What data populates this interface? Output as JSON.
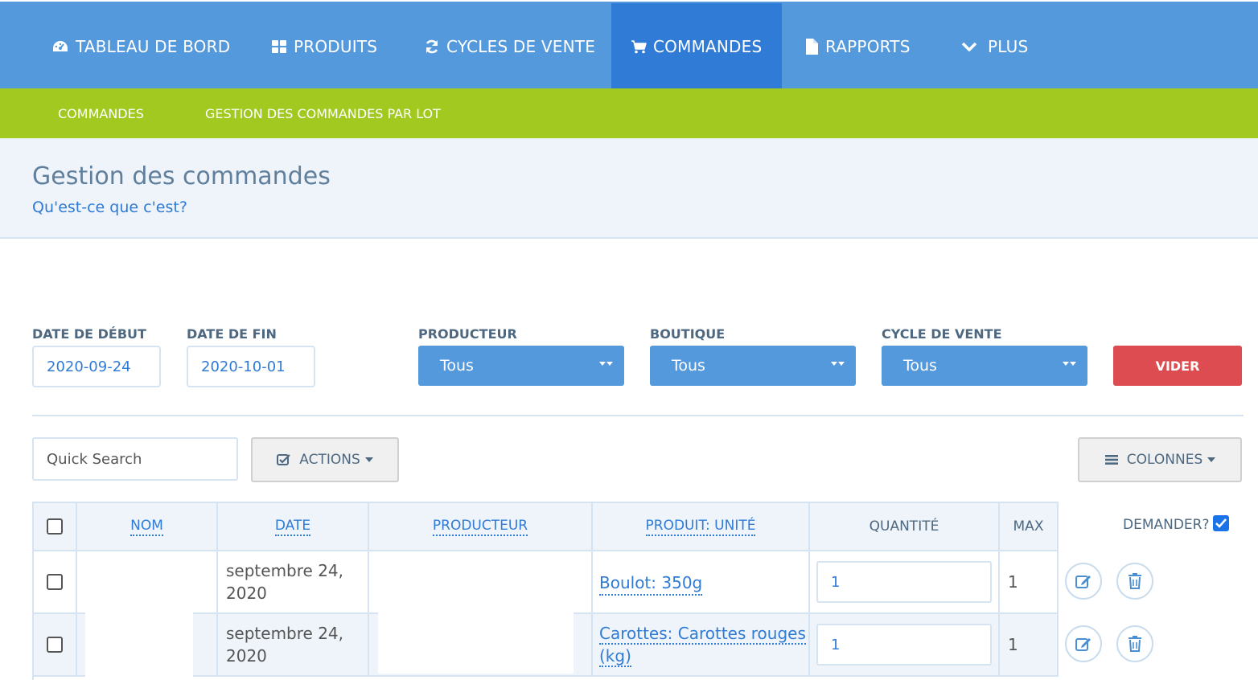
{
  "topnav": {
    "items": [
      {
        "label": "TABLEAU DE BORD",
        "icon": "dashboard-icon"
      },
      {
        "label": "PRODUITS",
        "icon": "grid-icon"
      },
      {
        "label": "CYCLES DE VENTE",
        "icon": "refresh-icon"
      },
      {
        "label": "COMMANDES",
        "icon": "cart-icon",
        "active": true
      },
      {
        "label": "RAPPORTS",
        "icon": "file-icon"
      },
      {
        "label": "PLUS",
        "icon": "chevron-down-icon"
      }
    ]
  },
  "subnav": {
    "items": [
      {
        "label": "COMMANDES"
      },
      {
        "label": "GESTION DES COMMANDES PAR LOT"
      }
    ]
  },
  "page": {
    "title": "Gestion des commandes",
    "help_link": "Qu'est-ce que c'est?"
  },
  "filters": {
    "start_date_label": "DATE DE DÉBUT",
    "start_date_value": "2020-09-24",
    "end_date_label": "DATE DE FIN",
    "end_date_value": "2020-10-01",
    "producer_label": "PRODUCTEUR",
    "producer_value": "Tous",
    "shop_label": "BOUTIQUE",
    "shop_value": "Tous",
    "cycle_label": "CYCLE DE VENTE",
    "cycle_value": "Tous",
    "clear_label": "VIDER"
  },
  "toolbar": {
    "search_placeholder": "Quick Search",
    "actions_label": "ACTIONS",
    "columns_label": "COLONNES"
  },
  "table": {
    "headers": {
      "name": "NOM",
      "date": "DATE",
      "producer": "PRODUCTEUR",
      "product": "PRODUIT: UNITÉ",
      "quantity": "QUANTITÉ",
      "max": "MAX",
      "request": "DEMANDER?"
    },
    "rows": [
      {
        "date_line1": "septembre 24,",
        "date_line2": "2020",
        "product_line1": "Boulot: 350g",
        "product_line2": "",
        "quantity": "1",
        "max": "1"
      },
      {
        "date_line1": "septembre 24,",
        "date_line2": "2020",
        "product_line1": "Carottes: Carottes rouges",
        "product_line2": "(kg)",
        "quantity": "1",
        "max": "1"
      }
    ]
  },
  "colors": {
    "topnav": "#5499dc",
    "topnav_active": "#2f7bd6",
    "subnav": "#a1c920",
    "danger": "#dc4c50",
    "link": "#2f7bd6"
  }
}
